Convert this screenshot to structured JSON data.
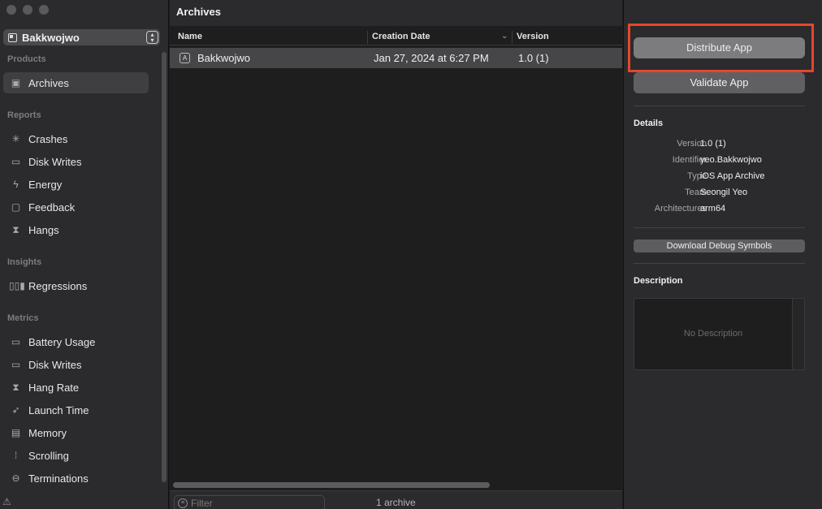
{
  "sidebar": {
    "app_selector": {
      "label": "Bakkwojwo"
    },
    "sections": {
      "products": "Products",
      "reports": "Reports",
      "insights": "Insights",
      "metrics": "Metrics"
    },
    "products": [
      {
        "label": "Archives",
        "icon": "archive-icon",
        "selected": true
      }
    ],
    "reports": [
      {
        "label": "Crashes",
        "icon": "crash-icon"
      },
      {
        "label": "Disk Writes",
        "icon": "disk-icon"
      },
      {
        "label": "Energy",
        "icon": "bolt-icon"
      },
      {
        "label": "Feedback",
        "icon": "speech-bubble-icon"
      },
      {
        "label": "Hangs",
        "icon": "hourglass-icon"
      }
    ],
    "insights": [
      {
        "label": "Regressions",
        "icon": "bar-chart-icon"
      }
    ],
    "metrics": [
      {
        "label": "Battery Usage",
        "icon": "battery-icon"
      },
      {
        "label": "Disk Writes",
        "icon": "disk-icon"
      },
      {
        "label": "Hang Rate",
        "icon": "hourglass-icon"
      },
      {
        "label": "Launch Time",
        "icon": "rocket-icon"
      },
      {
        "label": "Memory",
        "icon": "memory-chip-icon"
      },
      {
        "label": "Scrolling",
        "icon": "scroll-icon"
      },
      {
        "label": "Terminations",
        "icon": "minus-circle-icon"
      }
    ]
  },
  "center": {
    "title": "Archives",
    "columns": {
      "name": "Name",
      "creation_date": "Creation Date",
      "version": "Version"
    },
    "rows": [
      {
        "name": "Bakkwojwo",
        "creation_date": "Jan 27, 2024 at 6:27 PM",
        "version": "1.0 (1)"
      }
    ],
    "filter_placeholder": "Filter",
    "count": "1 archive"
  },
  "inspector": {
    "distribute_label": "Distribute App",
    "validate_label": "Validate App",
    "details_title": "Details",
    "details": {
      "version": {
        "key": "Version",
        "value": "1.0 (1)"
      },
      "identifier": {
        "key": "Identifier",
        "value": "yeo.Bakkwojwo"
      },
      "type": {
        "key": "Type",
        "value": "iOS App Archive"
      },
      "team": {
        "key": "Team",
        "value": "Seongil Yeo"
      },
      "architectures": {
        "key": "Architectures",
        "value": "arm64"
      }
    },
    "download_symbols_label": "Download Debug Symbols",
    "description_title": "Description",
    "description_placeholder": "No Description"
  },
  "colors": {
    "highlight": "#e4472c",
    "selected_row": "#464547"
  }
}
